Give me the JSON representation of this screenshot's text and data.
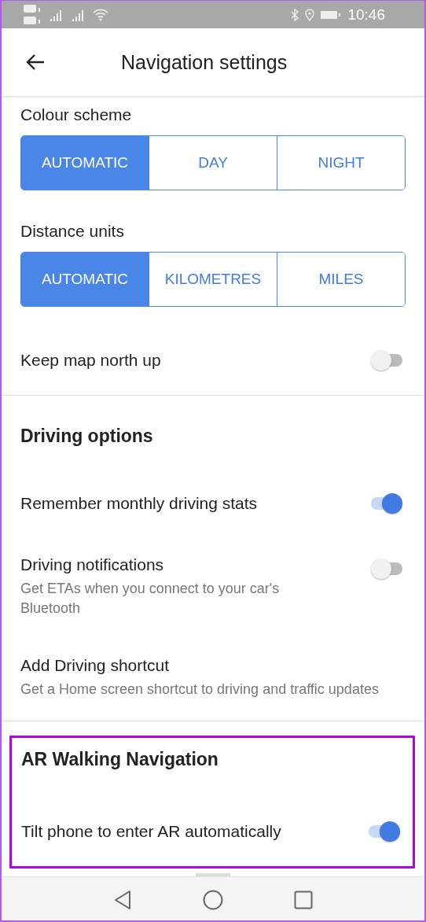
{
  "status_bar": {
    "time": "10:46"
  },
  "header": {
    "title": "Navigation settings"
  },
  "sections": [
    {
      "items": [
        {
          "kind": "segmented",
          "label": "Colour scheme",
          "options": [
            {
              "label": "AUTOMATIC",
              "selected": true
            },
            {
              "label": "DAY",
              "selected": false
            },
            {
              "label": "NIGHT",
              "selected": false
            }
          ]
        },
        {
          "kind": "segmented",
          "label": "Distance units",
          "options": [
            {
              "label": "AUTOMATIC",
              "selected": true
            },
            {
              "label": "KILOMETRES",
              "selected": false
            },
            {
              "label": "MILES",
              "selected": false
            }
          ]
        },
        {
          "kind": "toggle",
          "label": "Keep map north up",
          "on": false
        }
      ]
    },
    {
      "heading": "Driving options",
      "items": [
        {
          "kind": "toggle",
          "label": "Remember monthly driving stats",
          "on": true
        },
        {
          "kind": "toggle",
          "label": "Driving notifications",
          "description": "Get ETAs when you connect to your car's Bluetooth",
          "on": false
        },
        {
          "kind": "link",
          "label": "Add Driving shortcut",
          "description": "Get a Home screen shortcut to driving and traffic updates"
        }
      ]
    },
    {
      "heading": "AR Walking Navigation",
      "highlighted": true,
      "items": [
        {
          "kind": "toggle",
          "label": "Tilt phone to enter AR automatically",
          "on": true
        }
      ]
    }
  ]
}
